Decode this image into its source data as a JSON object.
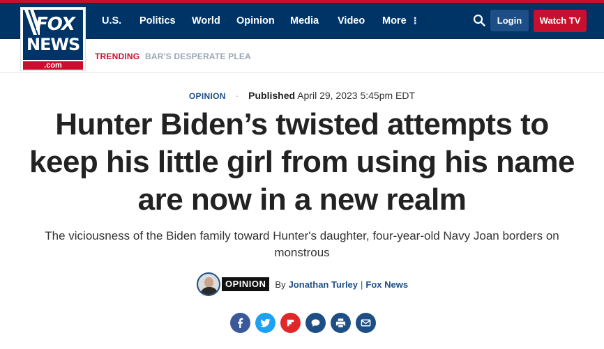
{
  "brand": {
    "logo_top": "FOX",
    "logo_bottom": "NEWS",
    "logo_domain": ".com"
  },
  "nav": {
    "items": [
      "U.S.",
      "Politics",
      "World",
      "Opinion",
      "Media",
      "Video"
    ],
    "more_label": "More",
    "login_label": "Login",
    "watch_label": "Watch TV"
  },
  "trending": {
    "label": "TRENDING",
    "link": "BAR'S DESPERATE PLEA"
  },
  "article": {
    "kicker": "OPINION",
    "published_label": "Published",
    "published_date": "April 29, 2023 5:45pm EDT",
    "headline": "Hunter Biden’s twisted attempts to keep his little girl from using his name are now in a new realm",
    "subhead": "The viciousness of the Biden family toward Hunter's daughter, four-year-old Navy Joan borders on monstrous",
    "badge": "OPINION",
    "by_label": "By",
    "author": "Jonathan Turley",
    "separator": "|",
    "source": "Fox News"
  },
  "share_icons": [
    "facebook-icon",
    "twitter-icon",
    "flipboard-icon",
    "comment-icon",
    "print-icon",
    "email-icon"
  ],
  "colors": {
    "navy": "#003366",
    "red": "#c8102e",
    "link_blue": "#1d4f86",
    "share_blue": "#1d4f86"
  }
}
